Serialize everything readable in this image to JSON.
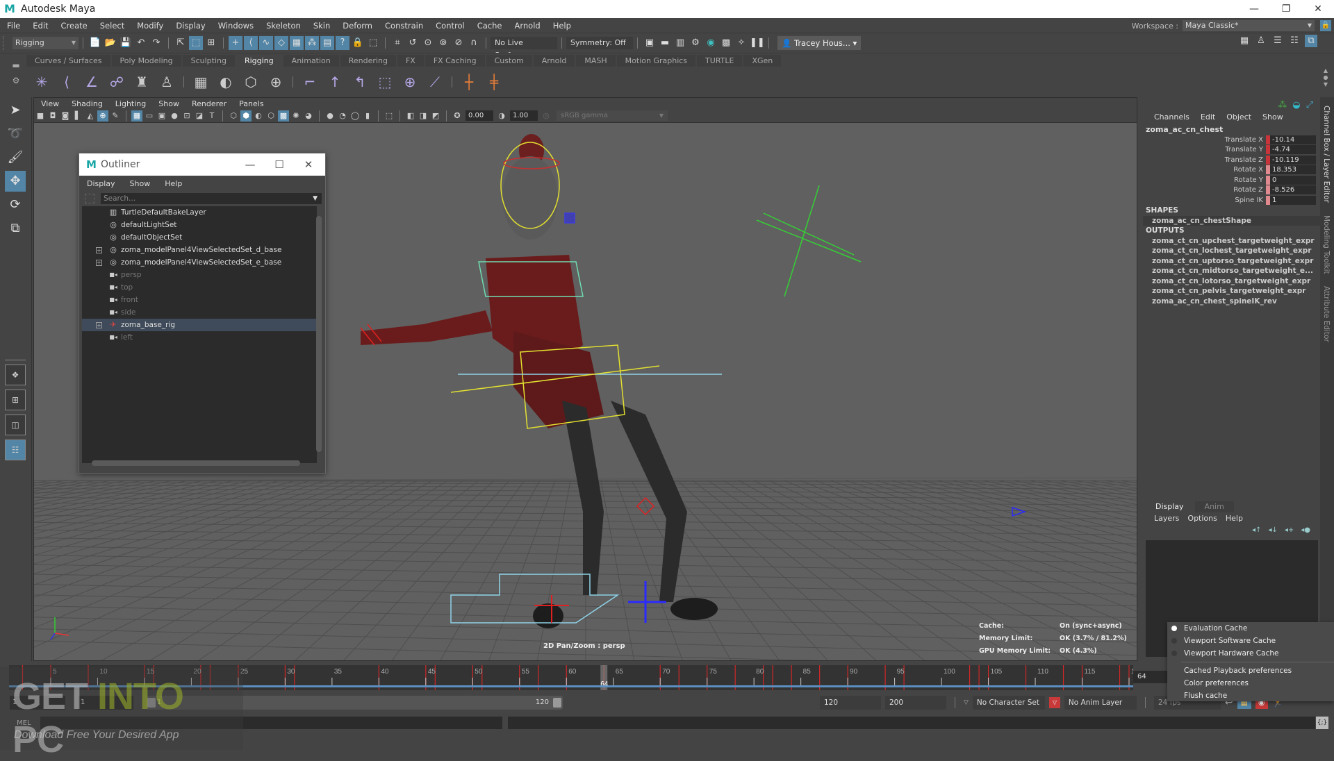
{
  "app": {
    "title": "Autodesk Maya",
    "logo": "M"
  },
  "window_controls": {
    "minimize": "—",
    "maximize": "❐",
    "close": "✕"
  },
  "menubar": {
    "items": [
      "File",
      "Edit",
      "Create",
      "Select",
      "Modify",
      "Display",
      "Windows",
      "Skeleton",
      "Skin",
      "Deform",
      "Constrain",
      "Control",
      "Cache",
      "Arnold",
      "Help"
    ],
    "workspace_label": "Workspace :",
    "workspace_value": "Maya Classic*"
  },
  "statusline": {
    "mode": "Rigging",
    "live_surface": "No Live Surface",
    "symmetry": "Symmetry: Off",
    "user": "Tracey Hous..."
  },
  "shelf": {
    "tabs": [
      "Curves / Surfaces",
      "Poly Modeling",
      "Sculpting",
      "Rigging",
      "Animation",
      "Rendering",
      "FX",
      "FX Caching",
      "Custom",
      "Arnold",
      "MASH",
      "Motion Graphics",
      "TURTLE",
      "XGen"
    ],
    "active_tab": "Rigging"
  },
  "viewport": {
    "menu": [
      "View",
      "Shading",
      "Lighting",
      "Show",
      "Renderer",
      "Panels"
    ],
    "exposure": "0.00",
    "gamma": "1.00",
    "color_space": "sRGB gamma",
    "camera_label": "2D Pan/Zoom : persp",
    "hud": [
      {
        "key": "Cache:",
        "value": "On (sync+async)"
      },
      {
        "key": "Memory Limit:",
        "value": "OK (3.7% / 81.2%)"
      },
      {
        "key": "GPU Memory Limit:",
        "value": "OK (4.3%)"
      }
    ]
  },
  "outliner": {
    "title": "Outliner",
    "menu": [
      "Display",
      "Show",
      "Help"
    ],
    "search_placeholder": "Search...",
    "items": [
      {
        "label": "TurtleDefaultBakeLayer",
        "icon": "bake-layer-icon",
        "expandable": false,
        "dim": false,
        "selected": false
      },
      {
        "label": "defaultLightSet",
        "icon": "set-icon",
        "expandable": false,
        "dim": false,
        "selected": false
      },
      {
        "label": "defaultObjectSet",
        "icon": "set-icon",
        "expandable": false,
        "dim": false,
        "selected": false
      },
      {
        "label": "zoma_modelPanel4ViewSelectedSet_d_base",
        "icon": "set-icon",
        "expandable": true,
        "dim": false,
        "selected": false
      },
      {
        "label": "zoma_modelPanel4ViewSelectedSet_e_base",
        "icon": "set-icon",
        "expandable": true,
        "dim": false,
        "selected": false
      },
      {
        "label": "persp",
        "icon": "camera-icon",
        "expandable": false,
        "dim": true,
        "selected": false
      },
      {
        "label": "top",
        "icon": "camera-icon",
        "expandable": false,
        "dim": true,
        "selected": false
      },
      {
        "label": "front",
        "icon": "camera-icon",
        "expandable": false,
        "dim": true,
        "selected": false
      },
      {
        "label": "side",
        "icon": "camera-icon",
        "expandable": false,
        "dim": true,
        "selected": false
      },
      {
        "label": "zoma_base_rig",
        "icon": "rig-icon",
        "expandable": true,
        "dim": false,
        "selected": true
      },
      {
        "label": "left",
        "icon": "camera-icon",
        "expandable": false,
        "dim": true,
        "selected": false
      }
    ]
  },
  "channelbox": {
    "menu": [
      "Channels",
      "Edit",
      "Object",
      "Show"
    ],
    "node": "zoma_ac_cn_chest",
    "attributes": [
      {
        "name": "Translate X",
        "value": "-10.14",
        "key_color": "#c8343a"
      },
      {
        "name": "Translate Y",
        "value": "-4.74",
        "key_color": "#c8343a"
      },
      {
        "name": "Translate Z",
        "value": "-10.119",
        "key_color": "#c8343a"
      },
      {
        "name": "Rotate X",
        "value": "18.353",
        "key_color": "#e08a90"
      },
      {
        "name": "Rotate Y",
        "value": "0",
        "key_color": "#e08a90"
      },
      {
        "name": "Rotate Z",
        "value": "-8.526",
        "key_color": "#e08a90"
      },
      {
        "name": "Spine IK",
        "value": "1",
        "key_color": "#e08a90"
      }
    ],
    "shapes_header": "SHAPES",
    "shapes": [
      "zoma_ac_cn_chestShape"
    ],
    "outputs_header": "OUTPUTS",
    "outputs": [
      "zoma_ct_cn_upchest_targetweight_expr",
      "zoma_ct_cn_lochest_targetweight_expr",
      "zoma_ct_cn_uptorso_targetweight_expr",
      "zoma_ct_cn_midtorso_targetweight_e...",
      "zoma_ct_cn_lotorso_targetweight_expr",
      "zoma_ct_cn_pelvis_targetweight_expr",
      "zoma_ac_cn_chest_spineIK_rev"
    ]
  },
  "layereditor": {
    "tabs": [
      "Display",
      "Anim"
    ],
    "active_tab": "Display",
    "menu": [
      "Layers",
      "Options",
      "Help"
    ]
  },
  "cache_menu": {
    "items": [
      {
        "label": "Evaluation Cache",
        "radio": true,
        "checked": true
      },
      {
        "label": "Viewport Software Cache",
        "radio": true,
        "checked": false
      },
      {
        "label": "Viewport Hardware Cache",
        "radio": true,
        "checked": false
      }
    ],
    "actions": [
      "Cached Playback preferences",
      "Color preferences",
      "Flush cache"
    ]
  },
  "side_tabs": [
    "Channel Box / Layer Editor",
    "Modeling Toolkit",
    "Attribute Editor"
  ],
  "timeline": {
    "start": 1,
    "end": 120,
    "major_step": 5,
    "current_frame": 64,
    "current_frame_field": "64",
    "keyframes": [
      2,
      5,
      9,
      15,
      16,
      21,
      22,
      25,
      30,
      31,
      40,
      45,
      46,
      50,
      51,
      55,
      57,
      60,
      64,
      70,
      72,
      75,
      78,
      81,
      82,
      84,
      87,
      90,
      94,
      96,
      103,
      104,
      105,
      109,
      113,
      115,
      119,
      120
    ]
  },
  "range": {
    "anim_start": "1",
    "playback_start": "1",
    "range_start_label": "1",
    "range_end_label": "120",
    "playback_end": "120",
    "anim_end": "200",
    "character_set": "No Character Set",
    "anim_layer": "No Anim Layer",
    "fps": "24 fps"
  },
  "cmdline": {
    "language": "MEL"
  },
  "watermark": {
    "brand_a": "GET ",
    "brand_b": "INTO",
    "brand_c": " PC",
    "tagline": "Download Free Your Desired App"
  }
}
